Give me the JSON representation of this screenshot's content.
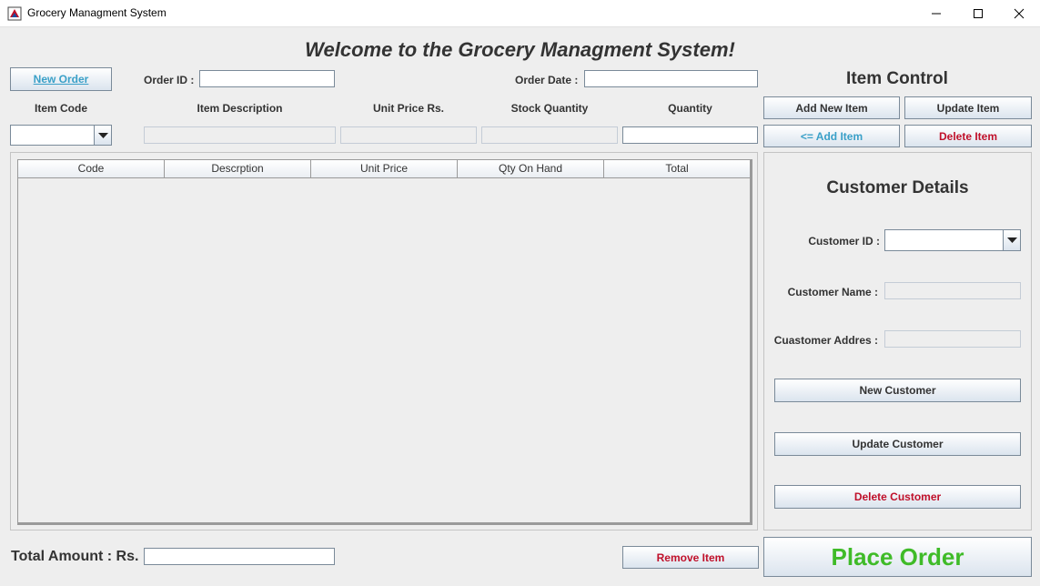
{
  "window": {
    "title": "Grocery Managment System"
  },
  "main_title": "Welcome to the Grocery Managment System!",
  "order": {
    "new_order_label": "New Order",
    "order_id_label": "Order ID :",
    "order_id_value": "",
    "order_date_label": "Order Date :",
    "order_date_value": ""
  },
  "item_headers": {
    "code": "Item Code",
    "description": "Item Description",
    "unit_price": "Unit Price Rs.",
    "stock": "Stock Quantity",
    "quantity": "Quantity"
  },
  "item_control": {
    "title": "Item Control",
    "add_new_item": "Add New Item",
    "update_item": "Update Item",
    "add_item": "<= Add Item",
    "delete_item": "Delete Item"
  },
  "table": {
    "columns": [
      "Code",
      "Descrption",
      "Unit Price",
      "Qty On Hand",
      "Total"
    ],
    "rows": []
  },
  "customer": {
    "title": "Customer Details",
    "id_label": "Customer ID :",
    "name_label": "Customer Name :",
    "address_label": "Cuastomer Addres :",
    "new_customer": "New Customer",
    "update_customer": "Update Customer",
    "delete_customer": "Delete Customer"
  },
  "footer": {
    "total_label": "Total Amount : Rs.",
    "total_value": "",
    "remove_item": "Remove Item",
    "place_order": "Place Order"
  },
  "colors": {
    "red_text": "#c0102a",
    "blue_text": "#3aa0c8",
    "green_text": "#3fbb28"
  },
  "icons": {
    "app": "java-app-icon",
    "minimize": "minimize-icon",
    "maximize": "maximize-icon",
    "close": "close-icon",
    "dropdown": "triangle-down-icon"
  }
}
